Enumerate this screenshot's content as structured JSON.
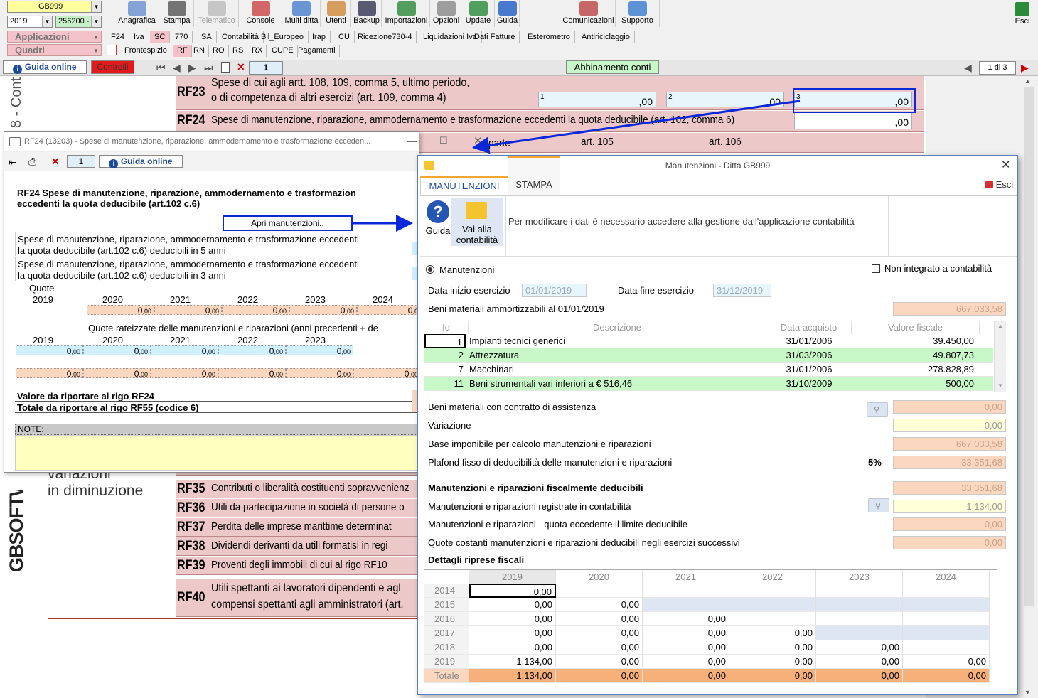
{
  "top": {
    "ditta_combo": "GB999",
    "year_combo": "2019",
    "code_combo": "256200 -",
    "applicazioni": "Applicazioni",
    "quadri": "Quadri",
    "toolbar": [
      {
        "label": "Anagrafica"
      },
      {
        "label": "Stampa"
      },
      {
        "label": "Telematico"
      },
      {
        "label": "Console"
      },
      {
        "label": "Multi ditta"
      },
      {
        "label": "Utenti"
      },
      {
        "label": "Backup"
      },
      {
        "label": "Importazioni"
      },
      {
        "label": "Opzioni"
      },
      {
        "label": "Update"
      },
      {
        "label": "Guida"
      },
      {
        "label": "Comunicazioni"
      },
      {
        "label": "Supporto"
      }
    ],
    "esci": "Esci",
    "app_tabs": [
      "F24",
      "Iva",
      "SC",
      "770",
      "ISA",
      "Contabilità",
      "Bil_Europeo",
      "Irap",
      "CU",
      "Ricezione730-4",
      "Liquidazioni Iva",
      "Dati Fatture",
      "Esterometro",
      "Antiriciclaggio"
    ],
    "quadri_tabs": [
      "Frontespizio",
      "RF",
      "RN",
      "RO",
      "RS",
      "RX",
      "CUPE",
      "Pagamenti"
    ]
  },
  "navbar": {
    "guida_online": "Guida online",
    "controlli": "Controlli",
    "page_field": "1",
    "abbinamento": "Abbinamento conti",
    "page_of": "1 di 3"
  },
  "bgform": {
    "side_label": "8 - Cont",
    "rf23_code": "RF23",
    "rf23_line1": "Spese di cui agli artt. 108, 109, comma 5, ultimo periodo,",
    "rf23_line2": "o di competenza di altri esercizi (art. 109, comma 4)",
    "rf23_f1_num": "1",
    "rf23_f1_val": ",00",
    "rf23_f2_num": "2",
    "rf23_f2_val": ",00",
    "rf23_f3_num": "3",
    "rf23_f3_val": ",00",
    "rf24_code": "RF24",
    "rf24_text": "Spese di manutenzione, riparazione, ammodernamento e trasformazione eccedenti la quota deducibile (art. 102, comma 6)",
    "rf24_val": ",00",
    "parte": "parte",
    "art105": "art. 105",
    "art106": "art. 106",
    "variazioni": "variazioni",
    "in_diminuzione": "in diminuzione",
    "brand": "GBSOFTW",
    "rows": [
      {
        "code": "RF35",
        "text": "Contributi o liberalità costituenti sopravvenienz"
      },
      {
        "code": "RF36",
        "text": "Utili da partecipazione in società di persone o"
      },
      {
        "code": "RF37",
        "text": "Perdita delle imprese marittime determinat"
      },
      {
        "code": "RF38",
        "text": "Dividendi derivanti da utili formatisi in regi"
      },
      {
        "code": "RF39",
        "text": "Proventi degli immobili di cui al rigo RF10"
      }
    ],
    "rf40_code": "RF40",
    "rf40_line1": "Utili spettanti ai lavoratori dipendenti e agl",
    "rf40_line2": "compensi spettanti agli amministratori (art."
  },
  "rfwin": {
    "title": "RF24 (13203) -  Spese di manutenzione, riparazione, ammodernamento e trasformazione ecceden...",
    "page": "1",
    "guida_online": "Guida online",
    "heading1": "RF24 Spese di manutenzione, riparazione, ammodernamento e trasformazion",
    "heading2": "eccedenti la quota deducibile (art.102 c.6)",
    "apri_btn": "Apri manutenzioni..",
    "row1_line1": "Spese di manutenzione, riparazione, ammodernamento e trasformazione eccedenti",
    "row1_line2": "la quota deducibile (art.102 c.6) deducibili in 5 anni",
    "row2_line1": "Spese di manutenzione, riparazione, ammodernamento e trasformazione eccedenti",
    "row2_line2": "la quota deducibile (art.102 c.6) deducibili in 3 anni",
    "quote": "Quote",
    "years_top": [
      "2019",
      "2020",
      "2021",
      "2022",
      "2023",
      "2024"
    ],
    "quote_rate": "Quote rateizzate delle manutenzioni e riparazioni (anni precedenti + de",
    "years_bottom": [
      "2019",
      "2020",
      "2021",
      "2022",
      "2023"
    ],
    "zero": "0",
    "dec": ",00",
    "valore": "Valore da riportare al rigo RF24",
    "totale": "Totale da riportare al rigo  RF55 (codice 6)",
    "note": "NOTE:"
  },
  "manwin": {
    "title": "Manutenzioni - Ditta GB999",
    "tab_manutenzioni": "MANUTENZIONI",
    "tab_stampa": "STAMPA",
    "esci": "Esci",
    "guida": "Guida",
    "vai_line1": "Vai alla",
    "vai_line2": "contabilità",
    "info": "Per modificare i dati è necessario accedere alla gestione dall'applicazione contabilità",
    "radio_label": "Manutenzioni",
    "non_integrato": "Non integrato a contabilità",
    "data_inizio_label": "Data inizio esercizio",
    "data_inizio": "01/01/2019",
    "data_fine_label": "Data fine esercizio",
    "data_fine": "31/12/2019",
    "beni_label": "Beni materiali ammortizzabili al 01/01/2019",
    "beni_val": "667.033,58",
    "grid1_headers": [
      "Id",
      "Descrizione",
      "Data acquisto",
      "Valore fiscale"
    ],
    "grid1_rows": [
      {
        "id": "1",
        "desc": "Impianti tecnici generici",
        "data": "31/01/2006",
        "val": "39.450,00"
      },
      {
        "id": "2",
        "desc": "Attrezzatura",
        "data": "31/03/2006",
        "val": "49.807,73"
      },
      {
        "id": "7",
        "desc": "Macchinari",
        "data": "31/01/2006",
        "val": "278.828,89"
      },
      {
        "id": "11",
        "desc": "Beni strumentali vari inferiori a € 516,46",
        "data": "31/10/2009",
        "val": "500,00"
      }
    ],
    "lines": [
      {
        "label": "Beni materiali con contratto di assistenza",
        "val": "0,00"
      },
      {
        "label": "Variazione",
        "val": "0,00"
      },
      {
        "label": "Base imponibile per calcolo manutenzioni e riparazioni",
        "val": "667.033,58"
      },
      {
        "label": "Plafond fisso di deducibilità delle manutenzioni e riparazioni",
        "val": "33.351,68",
        "pct": "5%"
      },
      {
        "label": "Manutenzioni e riparazioni fiscalmente deducibili",
        "val": "33.351,68"
      },
      {
        "label": "Manutenzioni e riparazioni registrate in contabilità",
        "val": "1.134,00"
      },
      {
        "label": "Manutenzioni e riparazioni - quota eccedente il limite deducibile",
        "val": "0,00"
      },
      {
        "label": "Quote costanti manutenzioni e riparazioni deducibili negli esercizi successivi",
        "val": "0,00"
      }
    ],
    "dettagli": "Dettagli riprese fiscali",
    "grid2_cols": [
      "2019",
      "2020",
      "2021",
      "2022",
      "2023",
      "2024"
    ],
    "grid2_rows": [
      {
        "year": "2014",
        "vals": [
          "0,00",
          "",
          "",
          "",
          "",
          ""
        ]
      },
      {
        "year": "2015",
        "vals": [
          "0,00",
          "0,00",
          "",
          "",
          "",
          ""
        ]
      },
      {
        "year": "2016",
        "vals": [
          "0,00",
          "0,00",
          "0,00",
          "",
          "",
          ""
        ]
      },
      {
        "year": "2017",
        "vals": [
          "0,00",
          "0,00",
          "0,00",
          "0,00",
          "",
          ""
        ]
      },
      {
        "year": "2018",
        "vals": [
          "0,00",
          "0,00",
          "0,00",
          "0,00",
          "0,00",
          ""
        ]
      },
      {
        "year": "2019",
        "vals": [
          "1.134,00",
          "0,00",
          "0,00",
          "0,00",
          "0,00",
          "0,00"
        ]
      },
      {
        "year": "Totale",
        "vals": [
          "1.134,00",
          "0,00",
          "0,00",
          "0,00",
          "0,00",
          "0,00"
        ]
      }
    ]
  },
  "colors": {
    "accent_blue": "#0a28d8",
    "pink_row": "#ecc8c8",
    "peach": "#fbd7bf",
    "green_row": "#c8f7c8",
    "red_btn": "#e21a1a"
  }
}
